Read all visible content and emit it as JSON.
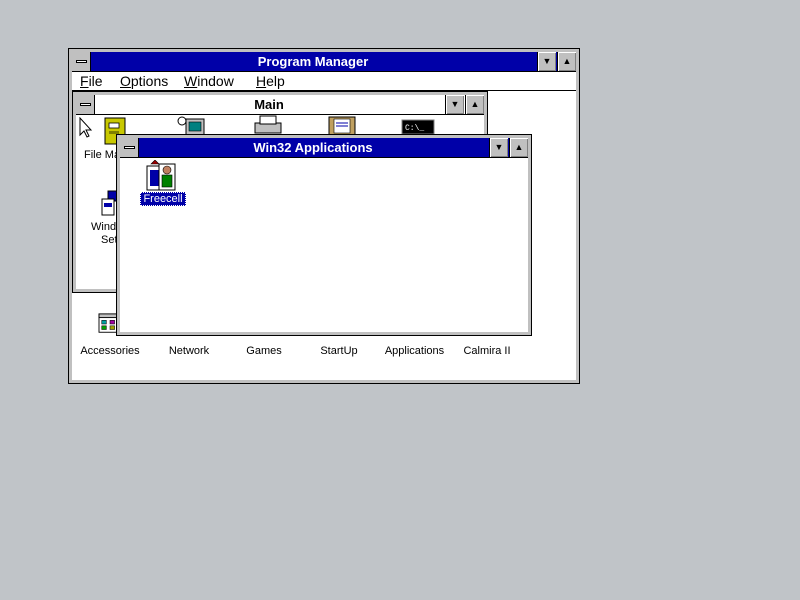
{
  "program_manager": {
    "title": "Program Manager",
    "menu": [
      "File",
      "Options",
      "Window",
      "Help"
    ]
  },
  "main_group": {
    "title": "Main",
    "icons": [
      "File Ma",
      "Windo",
      "Set"
    ]
  },
  "win32_group": {
    "title": "Win32 Applications",
    "icons": [
      {
        "label": "Freecell",
        "icon": "freecell-icon",
        "selected": true
      }
    ]
  },
  "group_icons": [
    "Accessories",
    "Network",
    "Games",
    "StartUp",
    "Applications",
    "Calmira II"
  ],
  "controls": {
    "minimize": "▼",
    "maximize": "▲"
  },
  "colors": {
    "desktop": "#c0c4c8",
    "titlebar_active": "#0000a8",
    "selection": "#0000a8"
  }
}
